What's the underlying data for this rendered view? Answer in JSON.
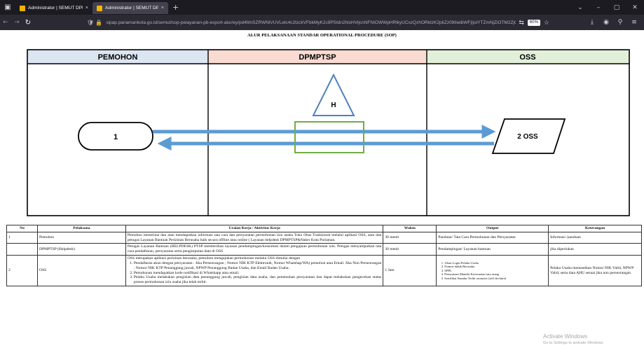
{
  "browser": {
    "tabs": [
      {
        "title": "Administrator | SEMUT DPM, P",
        "close": "×"
      },
      {
        "title": "Administrator | SEMUT DPM, P",
        "close": "×"
      }
    ],
    "new_tab": "+",
    "url": "sipap.pariamankota.go.id/semut/sop-pelayanan-pb-export-alur/ey/pd4llmSZRWNiVUVLelc4c2tzckVFbkMyK2c9PSIdn2hlsHVljcnNFNIOWWpHRlkyUCszQzhORktzK2pkZz09IiwibWFjIjoiYTZmNjZiOTM2ZjQ1Y",
    "zoom": "60%",
    "url_lock_glyph": "🛡 🔒",
    "window_controls": [
      "⌄",
      "–",
      "▢",
      "✕"
    ]
  },
  "sop": {
    "title": "ALUR PELAKSANAAN STANDAR OPERATIONAL PROCEDURE (SOP)",
    "lanes": [
      {
        "name": "PEMOHON",
        "color": "#dce6f2"
      },
      {
        "name": "DPMPTSP",
        "color": "#fadbd2"
      },
      {
        "name": "OSS",
        "color": "#e2f0d9"
      }
    ],
    "nodes": {
      "start": "1",
      "helpdesk": "H",
      "oss": "2  OSS"
    },
    "colors": {
      "arrow": "#5b9bd5",
      "triangle": "#4f81bd",
      "box": "#70ad47"
    }
  },
  "table": {
    "headers": [
      "No",
      "Pelaksana",
      "Uraian Kerja / Aktivitas Kerja",
      "Waktu",
      "Output",
      "Keterangan"
    ],
    "rows": [
      {
        "no": "1",
        "pelaksana": "Pemohon",
        "uraian": "Pemohon menerima dan atau mendapatkan informasi tata cara dan persyaratan permohonan izin usaha Toko Obat Tradisional melalui aplikasi OSS, atau dan petugas Layanan Bantuan Perizinan Berusaha baik secara offline atau online ( Layanan helpdesk DPMPTSP&Naker Kota Pariaman.",
        "waktu": "30 menit",
        "output": "Panduan/ Tata Cara Permohonan dan Persyaratan",
        "keterangan": "Informasi /panduan"
      },
      {
        "no": "",
        "pelaksana": "DPMPTSP (Helpdesk)",
        "uraian": "Petugas Layanan Bantuan (HELPDESK) PTSP memberikan layanan pendampingan/konsultasi dalam pengajuan permohonan izin. Petugas menyampaikan tata cara pendaftaran, persyaratan serta pengimputan data di OSS",
        "waktu": "30 menit",
        "output": "Pendampingan/ Layanan bantuan",
        "keterangan": "jika diperlukan"
      },
      {
        "no": "2",
        "pelaksana": "OSS",
        "uraian_intro": "OSS merupakan aplikasi perizinan  berusaha, pemohon mengajukan permohonan melalui OSS dimulai dengan",
        "uraian_steps": [
          "Pendaftaran akun dengan persyaratan : Jika Perseorangan ; Nomor NIK KTP Elektronik, Nomor Whatshap/WA) pemohon atau Email. Jika Non Perseorangan : Nomor NIK KTP Penanggung jawab, NPWP Penanggung Badan Usaha, dan Email Badan Usaha.",
          "Pemohonan mendapatkan kode notifikasi di Whatshapp atau email.",
          "Pelaku Usaha melakukan pengisian data penanggung jawab, pengisian data usaha, dan pemenuhan persyaratan dan dapat melakukan pengecekan status proses permohonan izin usaha jika telah terbit."
        ],
        "waktu": "1 Jam",
        "output_items": [
          "Akun Login Pelaku Usaha",
          "Nomor induk Berusaha",
          "SPPL",
          "Pernyataan Mandiri Kesesuaian tata ruang",
          "Sertifikat Standar Terbit otomotis (self declaire)"
        ],
        "keterangan": "Pelaku Usaha memastikan Nomor NIK Valid, NPWP Valid, serta data AHU sesuai jika non perseorangan"
      }
    ]
  },
  "watermark": {
    "line1": "Activate Windows",
    "line2": "Go to Settings to activate Windows."
  }
}
